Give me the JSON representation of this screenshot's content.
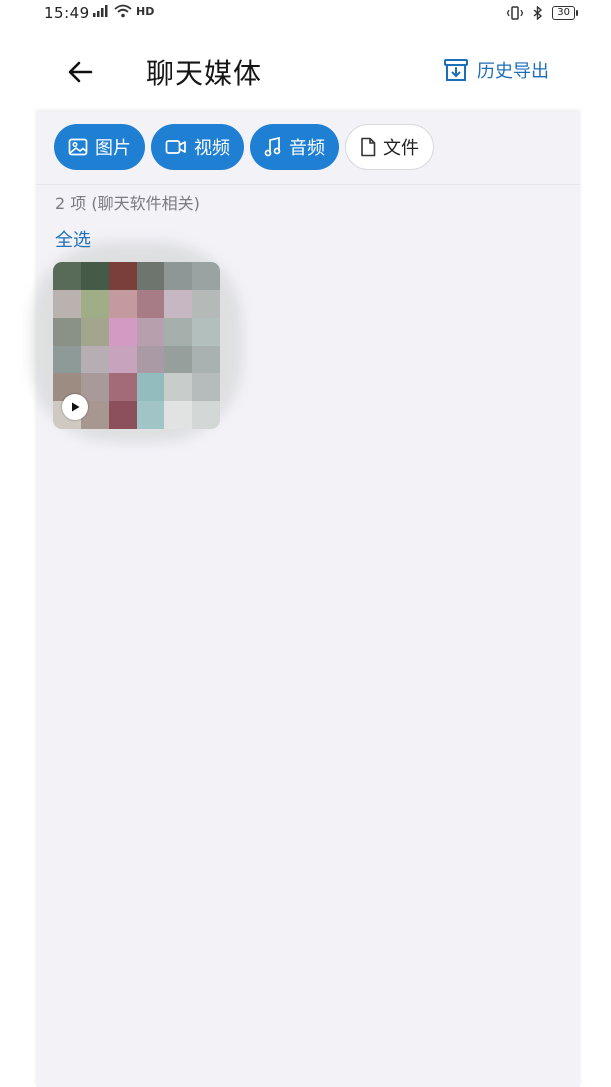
{
  "status": {
    "time": "15:49",
    "network_label": "4G",
    "hd_label": "HD",
    "battery": "30"
  },
  "header": {
    "title": "聊天媒体",
    "back_icon": "arrow-left-icon",
    "export_label": "历史导出",
    "export_icon": "archive-download-icon"
  },
  "filters": [
    {
      "label": "图片",
      "icon": "image-icon",
      "active": true
    },
    {
      "label": "视频",
      "icon": "video-camera-icon",
      "active": true
    },
    {
      "label": "音频",
      "icon": "music-note-icon",
      "active": true
    },
    {
      "label": "文件",
      "icon": "file-icon",
      "active": false
    }
  ],
  "content": {
    "count_text": "2 项 (聊天软件相关)",
    "select_all": "全选"
  },
  "colors": {
    "accent": "#1f7fd3",
    "link": "#1f6fb8",
    "panel_bg": "#f3f2f7"
  }
}
